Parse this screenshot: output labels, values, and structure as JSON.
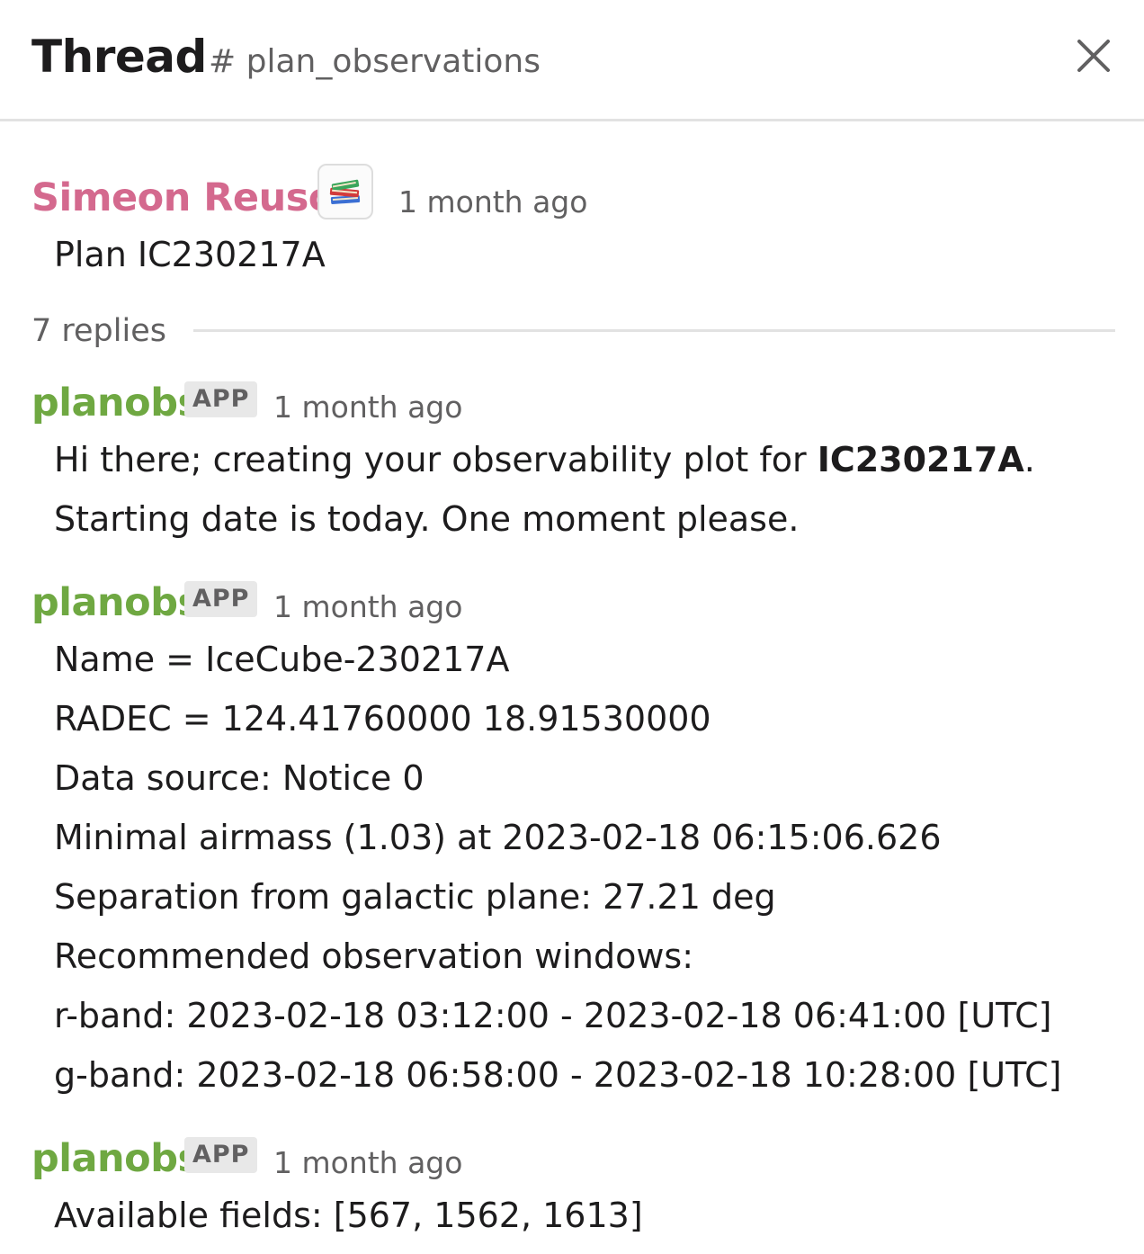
{
  "header": {
    "title": "Thread",
    "channel": "# plan_observations"
  },
  "root_message": {
    "author": "Simeon Reusch",
    "status_emoji": "books-icon",
    "timestamp": "1 month ago",
    "text": "Plan IC230217A"
  },
  "replies": {
    "count_label": "7 replies"
  },
  "messages": [
    {
      "author": "planobs",
      "badge": "APP",
      "timestamp": "1 month ago",
      "line1_pre": "Hi there; creating your observability plot for ",
      "line1_bold": "IC230217A",
      "line1_post": ".",
      "line2": "Starting date is today. One moment please."
    },
    {
      "author": "planobs",
      "badge": "APP",
      "timestamp": "1 month ago",
      "lines": [
        "Name = IceCube-230217A",
        "RADEC = 124.41760000 18.91530000",
        "Data source: Notice 0",
        "Minimal airmass (1.03) at 2023-02-18 06:15:06.626",
        "Separation from galactic plane: 27.21 deg",
        "Recommended observation windows:",
        "r-band: 2023-02-18 03:12:00 - 2023-02-18 06:41:00 [UTC]",
        "g-band: 2023-02-18 06:58:00 - 2023-02-18 10:28:00 [UTC]"
      ]
    },
    {
      "author": "planobs",
      "badge": "APP",
      "timestamp": "1 month ago",
      "text": "Available fields: [567, 1562, 1613]"
    }
  ],
  "colors": {
    "human_author": "#d4698e",
    "bot_author": "#6fa842",
    "muted_text": "#616061",
    "divider": "#e2e2e2"
  }
}
